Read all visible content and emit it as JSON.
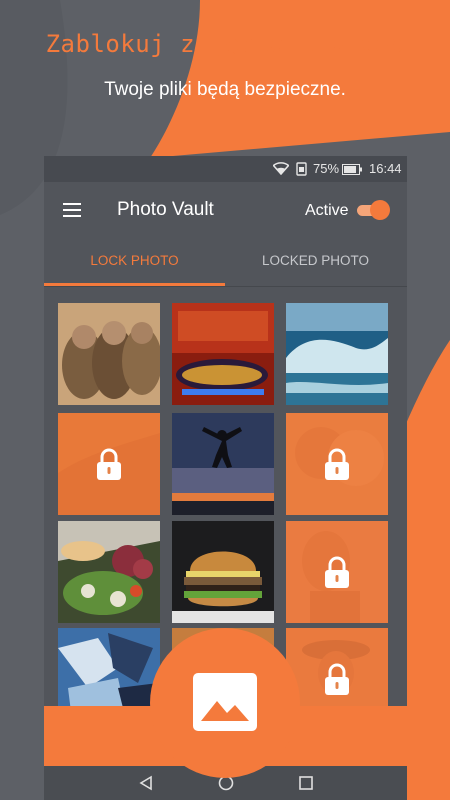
{
  "promo": {
    "title": "Zablokuj zdjęcia i wideo",
    "subtitle": "Twoje pliki będą bezpieczne."
  },
  "status_bar": {
    "battery": "75%",
    "time": "16:44"
  },
  "toolbar": {
    "title": "Photo Vault",
    "active_label": "Active"
  },
  "tabs": [
    {
      "label": "LOCK PHOTO",
      "selected": true
    },
    {
      "label": "LOCKED PHOTO",
      "selected": false
    }
  ],
  "photos": [
    {
      "subject": "monkeys",
      "locked": false
    },
    {
      "subject": "carnival-ride",
      "locked": false
    },
    {
      "subject": "ocean-wave",
      "locked": false
    },
    {
      "subject": "autumn-field",
      "locked": true
    },
    {
      "subject": "jumping-person",
      "locked": false
    },
    {
      "subject": "couple",
      "locked": true
    },
    {
      "subject": "salad",
      "locked": false
    },
    {
      "subject": "burger",
      "locked": false
    },
    {
      "subject": "woman-portrait",
      "locked": true
    },
    {
      "subject": "graffiti",
      "locked": false
    },
    {
      "subject": "photo-hidden",
      "locked": false
    },
    {
      "subject": "girl-with-hat",
      "locked": true
    }
  ],
  "colors": {
    "accent": "#f47a3c",
    "background": "#5d6066",
    "app_surface": "#52555b"
  },
  "icons": {
    "menu": "hamburger-menu-icon",
    "wifi": "wifi-icon",
    "lock": "padlock-icon",
    "add_photo": "image-icon"
  }
}
